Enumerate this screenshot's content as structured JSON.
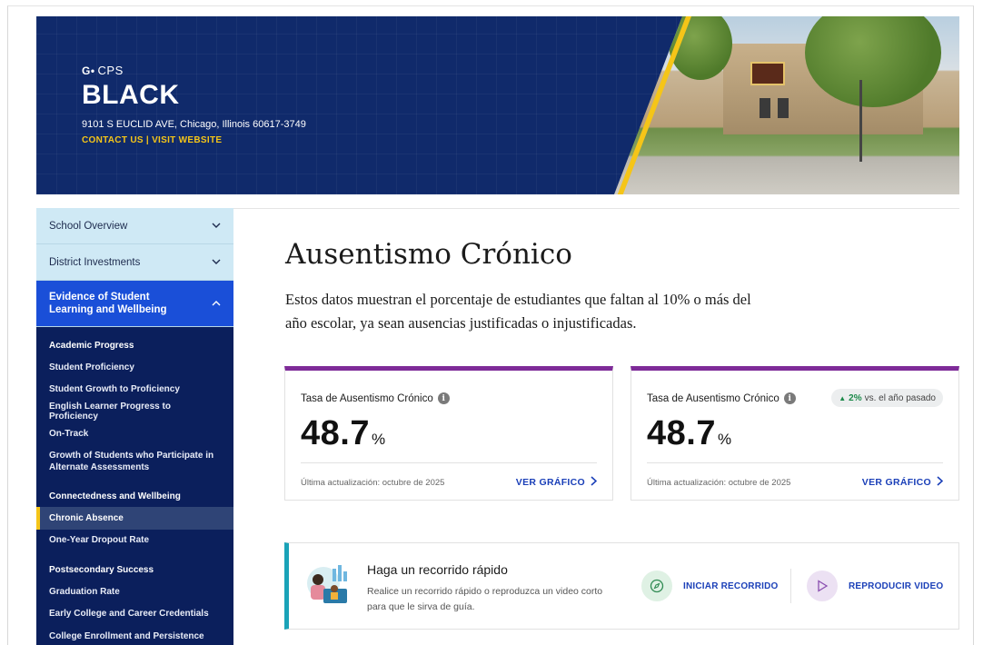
{
  "header": {
    "logo_text": "CPS",
    "school_name": "BLACK",
    "address": "9101 S EUCLID AVE, Chicago, Illinois 60617-3749",
    "contact_label": "CONTACT US",
    "link_separator": " | ",
    "website_label": "VISIT WEBSITE",
    "accent_color": "#f5c518",
    "brand_color": "#102a6b"
  },
  "sidebar": {
    "accordions": [
      {
        "label": "School Overview",
        "expanded": false
      },
      {
        "label": "District Investments",
        "expanded": false
      },
      {
        "label": "Evidence of Student Learning and Wellbeing",
        "expanded": true
      }
    ],
    "groups": [
      {
        "heading": "Academic Progress",
        "items": [
          "Student Proficiency",
          "Student Growth to Proficiency",
          "English Learner Progress to Proficiency",
          "On-Track",
          "Growth of Students who Participate in Alternate Assessments"
        ]
      },
      {
        "heading": "Connectedness and Wellbeing",
        "items": [
          "Chronic Absence",
          "One-Year Dropout Rate"
        ]
      },
      {
        "heading": "Postsecondary Success",
        "items": [
          "Graduation Rate",
          "Early College and Career Credentials",
          "College Enrollment and Persistence"
        ]
      }
    ],
    "current_item": "Chronic Absence"
  },
  "main": {
    "title": "Ausentismo Crónico",
    "description": "Estos datos muestran el porcentaje de estudiantes que faltan al 10% o más del año escolar, ya sean ausencias justificadas o injustificadas.",
    "cards": [
      {
        "label": "Tasa de Ausentismo Crónico",
        "value": "48.7",
        "unit": "%",
        "updated": "Última actualización: octubre de 2025",
        "link_label": "VER GRÁFICO"
      },
      {
        "label": "Tasa de Ausentismo Crónico",
        "value": "48.7",
        "unit": "%",
        "updated": "Última actualización: octubre de 2025",
        "link_label": "VER GRÁFICO",
        "delta_value": "2%",
        "delta_text": " vs. el año pasado",
        "delta_direction": "up"
      }
    ],
    "card_accent": "#7e2b98",
    "tour": {
      "title": "Haga un recorrido rápido",
      "description": "Realice un recorrido rápido o reproduzca un video corto para que le sirva de guía.",
      "start_label": "INICIAR RECORRIDO",
      "video_label": "REPRODUCIR VIDEO",
      "accent": "#1aa3b8"
    }
  }
}
